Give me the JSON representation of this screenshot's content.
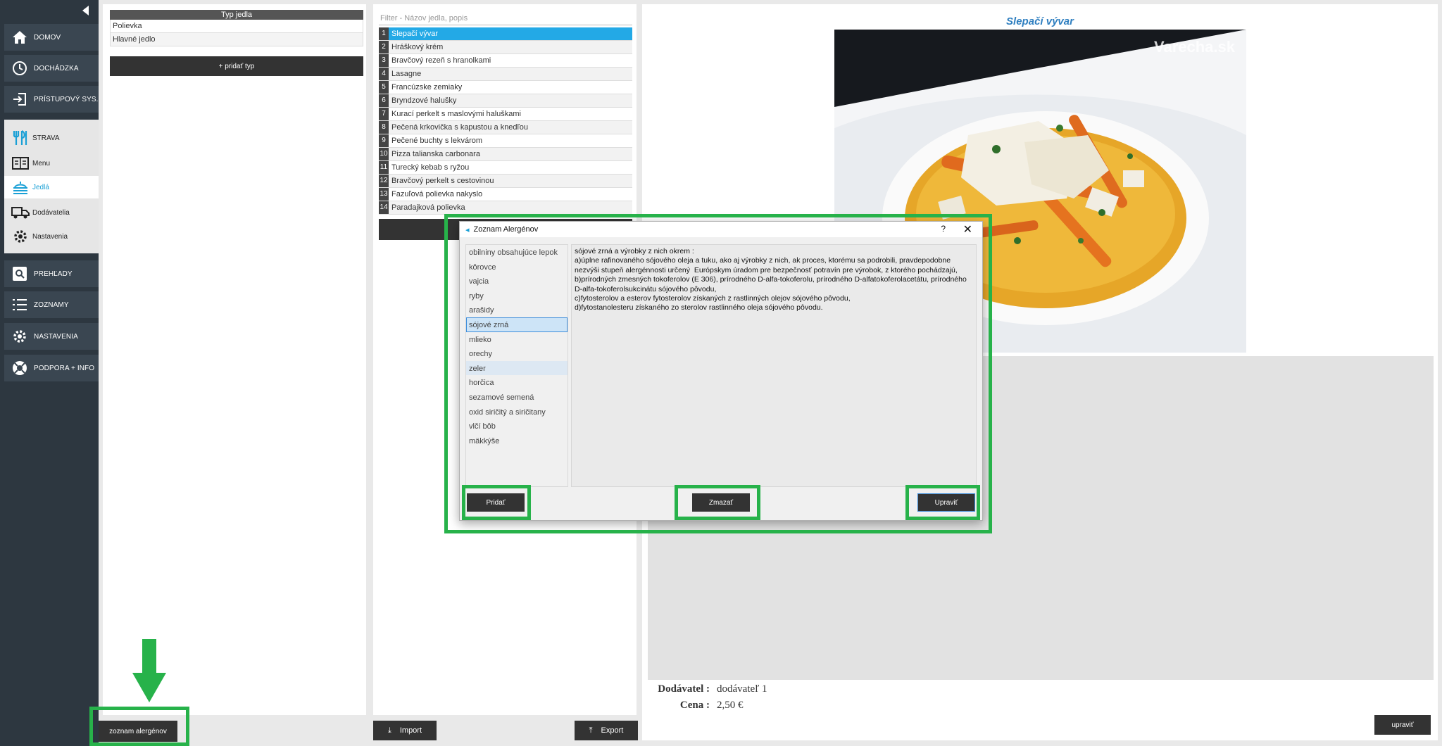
{
  "sidebar": {
    "nav": [
      {
        "label": "DOMOV",
        "icon": "home-icon"
      },
      {
        "label": "DOCHÁDZKA",
        "icon": "clock-icon"
      },
      {
        "label": "PRÍSTUPOVÝ SYS.",
        "icon": "login-icon"
      }
    ],
    "strava": {
      "label": "STRAVA",
      "items": [
        {
          "label": "Menu",
          "icon": "menu-book-icon"
        },
        {
          "label": "Jedlá",
          "icon": "dish-icon"
        },
        {
          "label": "Dodávatelia",
          "icon": "truck-icon"
        },
        {
          "label": "Nastavenia",
          "icon": "gear-icon"
        }
      ]
    },
    "nav2": [
      {
        "label": "PREHĽADY",
        "icon": "search-icon"
      },
      {
        "label": "ZOZNAMY",
        "icon": "list-icon"
      },
      {
        "label": "NASTAVENIA",
        "icon": "gear-icon"
      },
      {
        "label": "PODPORA + INFO",
        "icon": "lifebuoy-icon"
      }
    ]
  },
  "types": {
    "header": "Typ jedla",
    "rows": [
      "Polievka",
      "Hlavné jedlo"
    ],
    "add_label": "+ pridať typ"
  },
  "dishes": {
    "filter_placeholder": "Filter - Názov jedla, popis",
    "items": [
      {
        "num": "1",
        "name": "Slepačí vývar"
      },
      {
        "num": "2",
        "name": "Hráškový krém"
      },
      {
        "num": "3",
        "name": "Bravčový rezeň s hranolkami"
      },
      {
        "num": "4",
        "name": "Lasagne"
      },
      {
        "num": "5",
        "name": "Francúzske zemiaky"
      },
      {
        "num": "6",
        "name": "Bryndzové halušky"
      },
      {
        "num": "7",
        "name": "Kurací perkelt s maslovými haluškami"
      },
      {
        "num": "8",
        "name": "Pečená krkovička s kapustou a knedľou"
      },
      {
        "num": "9",
        "name": "Pečené buchty s lekvárom"
      },
      {
        "num": "10",
        "name": "Pizza talianska carbonara"
      },
      {
        "num": "11",
        "name": "Turecký kebab s ryžou"
      },
      {
        "num": "12",
        "name": "Bravčový perkelt s cestovinou"
      },
      {
        "num": "13",
        "name": "Fazuľová polievka nakyslo"
      },
      {
        "num": "14",
        "name": "Paradajková polievka"
      }
    ]
  },
  "detail": {
    "title": "Slepačí vývar",
    "watermark": "Varecha.sk",
    "supplier_label": "Dodávatel :",
    "supplier_value": "dodávateľ 1",
    "price_label": "Cena :",
    "price_value": "2,50 €",
    "edit_label": "upraviť"
  },
  "bottom": {
    "allergen_list_label": "zoznam alergénov",
    "import_label": "Import",
    "export_label": "Export"
  },
  "dialog": {
    "title": "Zoznam Alergénov",
    "help": "?",
    "close": "✕",
    "allergens": [
      "obilniny obsahujúce lepok",
      "kôrovce",
      "vajcia",
      "ryby",
      "arašidy",
      "sójové zrná",
      "mlieko",
      "orechy",
      "zeler",
      "horčica",
      "sezamové semená",
      "oxid siričitý a siričitany",
      "vlčí bôb",
      "mäkkýše"
    ],
    "selected_index": 5,
    "description": "sójové zrná a výrobky z nich okrem :\na)úplne rafinovaného sójového oleja a tuku, ako aj výrobky z nich, ak proces, ktorému sa podrobili, pravdepodobne nezvýši stupeň alergénnosti určený  Európskym úradom pre bezpečnosť potravín pre výrobok, z ktorého pochádzajú,\nb)prírodných zmesných tokoferolov (E 306), prírodného D-alfa-tokoferolu, prírodného D-alfatokoferolacetátu, prírodného D-alfa-tokoferolsukcinátu sójového pôvodu,\nc)fytosterolov a esterov fytosterolov získaných z rastlinných olejov sójového pôvodu,\nd)fytostanolesteru získaného zo sterolov rastlinného oleja sójového pôvodu.",
    "add_label": "Pridať",
    "delete_label": "Zmazať",
    "edit_label": "Upraviť"
  },
  "colors": {
    "sidebar": "#2d3740",
    "accent": "#1aa0d6",
    "highlight": "#27b24a",
    "selected_row": "#23a9e6"
  }
}
